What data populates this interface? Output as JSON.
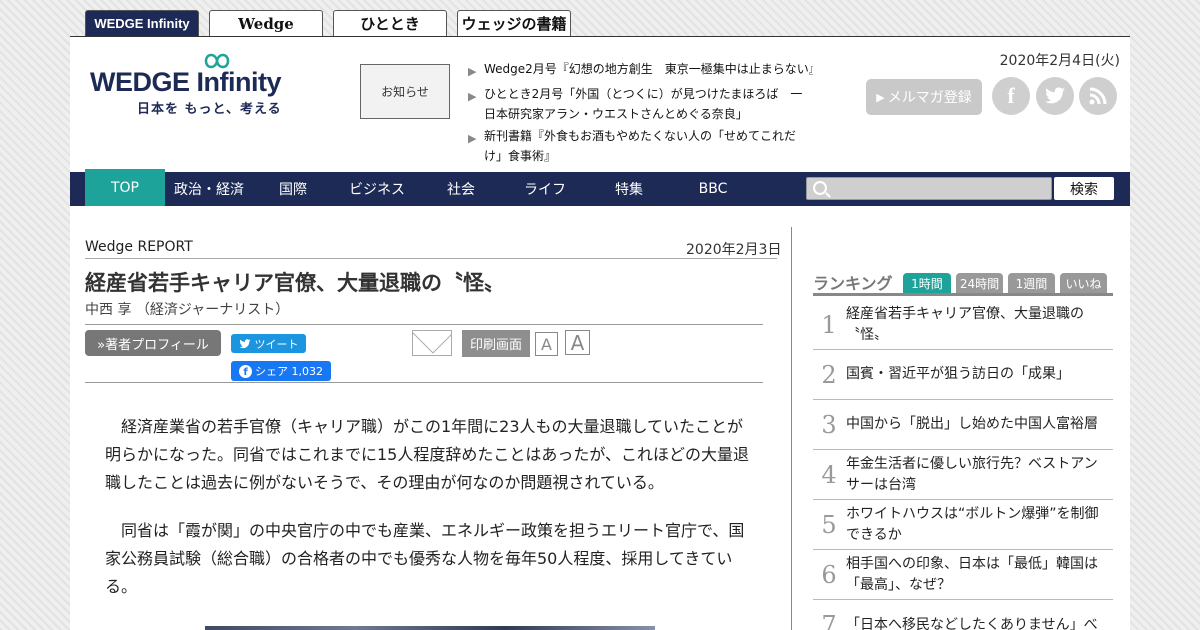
{
  "site_tabs": [
    "WEDGE Infinity",
    "Wedge",
    "ひととき",
    "ウェッジの書籍"
  ],
  "logo": {
    "main": "WEDGE Infinity",
    "tagline": "日本を もっと、考える"
  },
  "notice_label": "お知らせ",
  "news": [
    "Wedge2月号『幻想の地方創生　東京一極集中は止まらない』",
    "ひととき2月号「外国（とつくに）が見つけたまほろば　一日本研究家アラン・ウエストさんとめぐる奈良」",
    "新刊書籍『外食もお酒もやめたくない人の「せめてこれだけ」食事術』"
  ],
  "date": "2020年2月4日(火)",
  "mailmag_label": "メルマガ登録",
  "social_icons": [
    "facebook-icon",
    "twitter-icon",
    "rss-icon"
  ],
  "nav": [
    "TOP",
    "政治・経済",
    "国際",
    "ビジネス",
    "社会",
    "ライフ",
    "特集",
    "BBC"
  ],
  "search": {
    "button": "検索",
    "placeholder": ""
  },
  "article": {
    "category": "Wedge REPORT",
    "date": "2020年2月3日",
    "title": "経産省若手キャリア官僚、大量退職の〝怪〟",
    "author": "中西 享 （経済ジャーナリスト）",
    "profile_button": "»著者プロフィール",
    "tweet_label": "ツイート",
    "share_label": "シェア 1,032",
    "print_label": "印刷画面",
    "font_small": "A",
    "font_large": "A",
    "paragraphs": [
      "経済産業省の若手官僚（キャリア職）がこの1年間に23人もの大量退職していたことが明らかになった。同省ではこれまでに15人程度辞めたことはあったが、これほどの大量退職したことは過去に例がないそうで、その理由が何なのか問題視されている。",
      "同省は「霞が関」の中央官庁の中でも産業、エネルギー政策を担うエリート官庁で、国家公務員試験（総合職）の合格者の中でも優秀な人物を毎年50人程度、採用してきている。"
    ]
  },
  "ranking": {
    "title": "ランキング",
    "tabs": [
      "1時間",
      "24時間",
      "1週間",
      "いいね"
    ],
    "items": [
      {
        "rank": "1",
        "text": "経産省若手キャリア官僚、大量退職の〝怪〟"
      },
      {
        "rank": "2",
        "text": "国賓・習近平が狙う訪日の「成果」"
      },
      {
        "rank": "3",
        "text": "中国から「脱出」し始めた中国人富裕層"
      },
      {
        "rank": "4",
        "text": "年金生活者に優しい旅行先？ベストアンサーは台湾"
      },
      {
        "rank": "5",
        "text": "ホワイトハウスは“ボルトン爆弾”を制御できるか"
      },
      {
        "rank": "6",
        "text": "相手国への印象、日本は「最低」韓国は「最高」、なぜ？"
      },
      {
        "rank": "7",
        "text": "「日本へ移民などしたくありません」べ"
      }
    ]
  },
  "colors": {
    "navy": "#1d2a55",
    "accent": "#1ea39a"
  }
}
